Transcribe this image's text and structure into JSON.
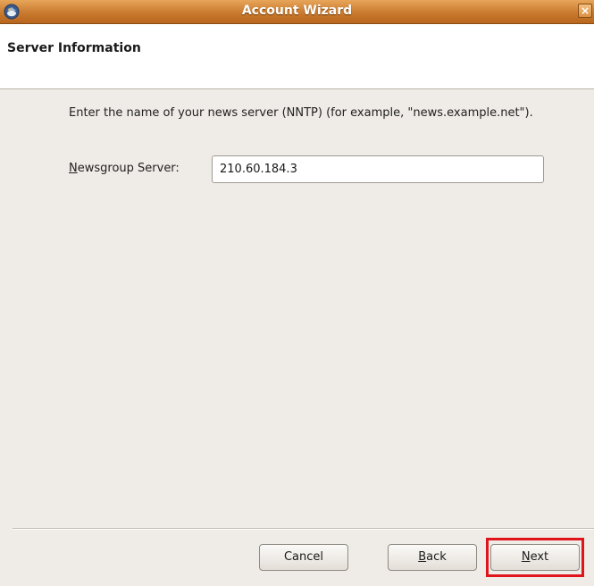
{
  "window": {
    "title": "Account Wizard",
    "close_glyph": "×"
  },
  "header": {
    "page_title": "Server Information"
  },
  "main": {
    "description": "Enter the name of your news server (NNTP) (for example, \"news.example.net\").",
    "server_field": {
      "label_mnemonic": "N",
      "label_rest": "ewsgroup Server:",
      "value": "210.60.184.3"
    }
  },
  "footer": {
    "cancel_label": "Cancel",
    "back_mnemonic": "B",
    "back_rest": "ack",
    "next_mnemonic": "N",
    "next_rest": "ext"
  },
  "colors": {
    "titlebar": "#c97a2e",
    "highlight": "#e0141b",
    "background": "#efebe7"
  },
  "icons": {
    "app": "thunderbird-icon",
    "close": "close-icon"
  }
}
